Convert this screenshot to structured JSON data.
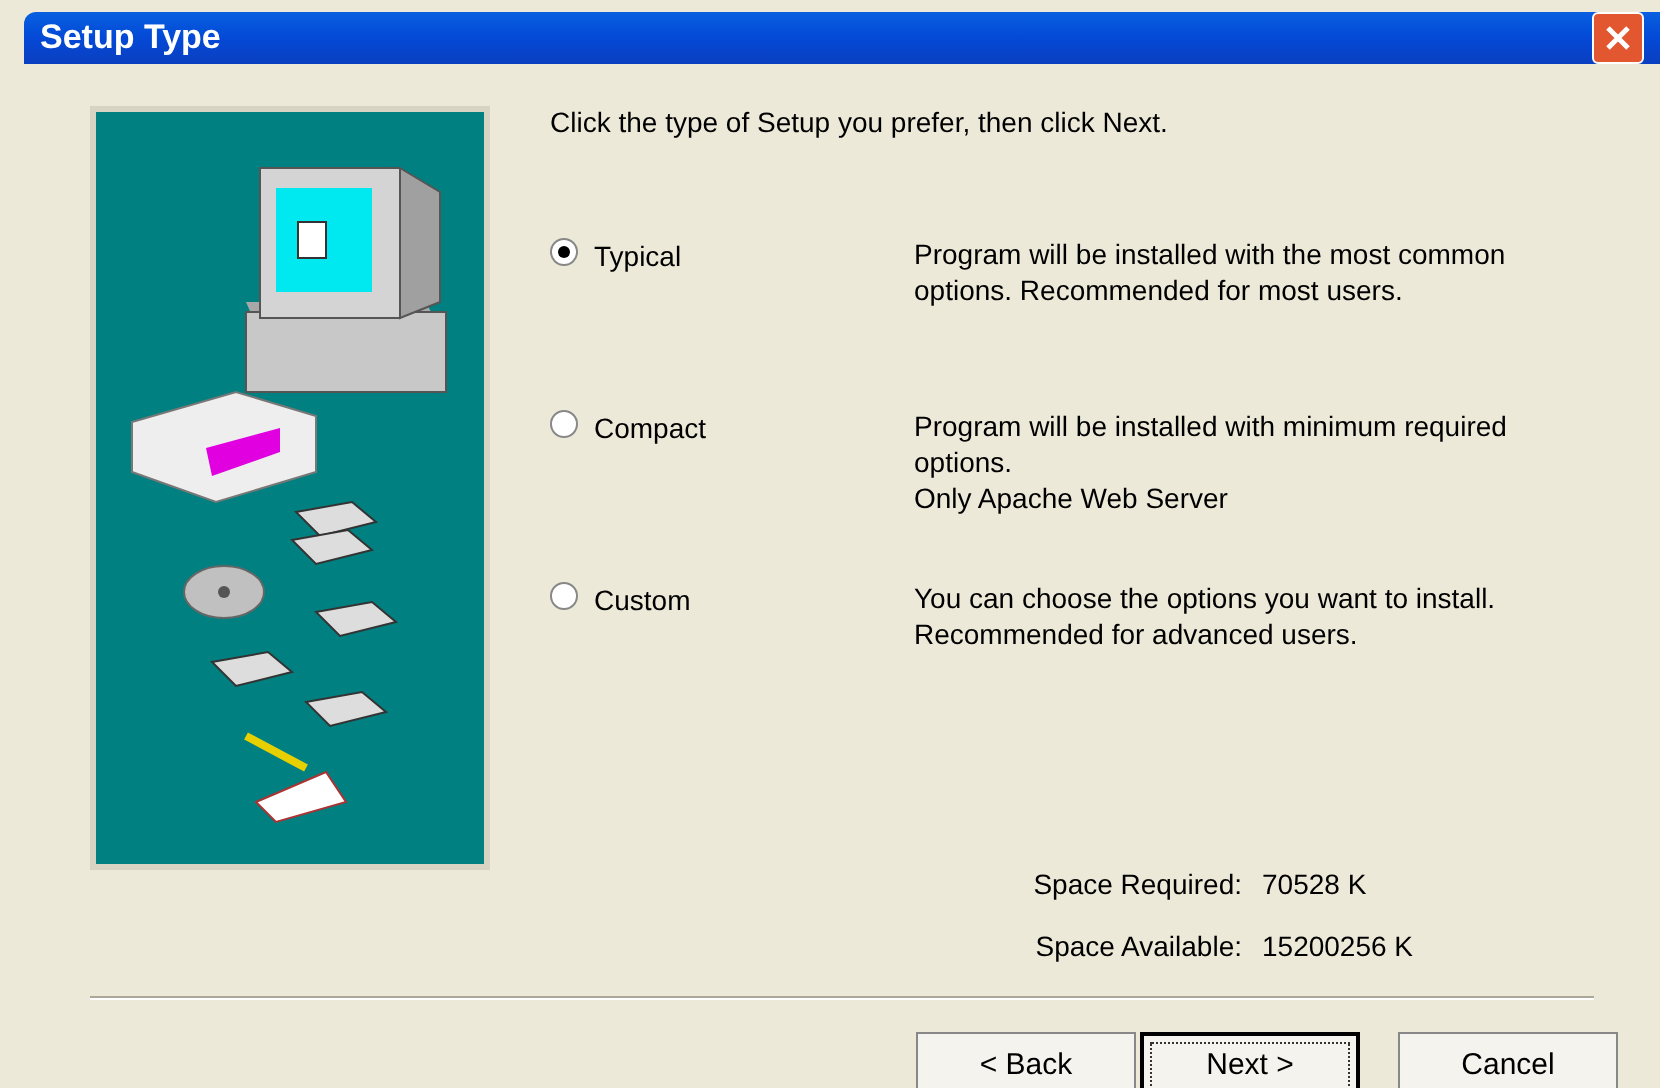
{
  "window": {
    "title": "Setup Type"
  },
  "instruction": "Click the type of Setup you prefer, then click Next.",
  "options": [
    {
      "label": "Typical",
      "selected": true,
      "description": "Program will be installed with the most common options. Recommended for most users."
    },
    {
      "label": "Compact",
      "selected": false,
      "description": "Program will be installed with minimum required options.\nOnly Apache Web Server"
    },
    {
      "label": "Custom",
      "selected": false,
      "description": "You can choose the options you want to install. Recommended for advanced users."
    }
  ],
  "space": [
    {
      "label": "Space Required:",
      "value": "70528 K"
    },
    {
      "label": "Space Available:",
      "value": "15200256 K"
    }
  ],
  "buttons": [
    {
      "label": "< Back",
      "default": false
    },
    {
      "label": "Next >",
      "default": true
    },
    {
      "label": "Cancel",
      "default": false
    }
  ]
}
